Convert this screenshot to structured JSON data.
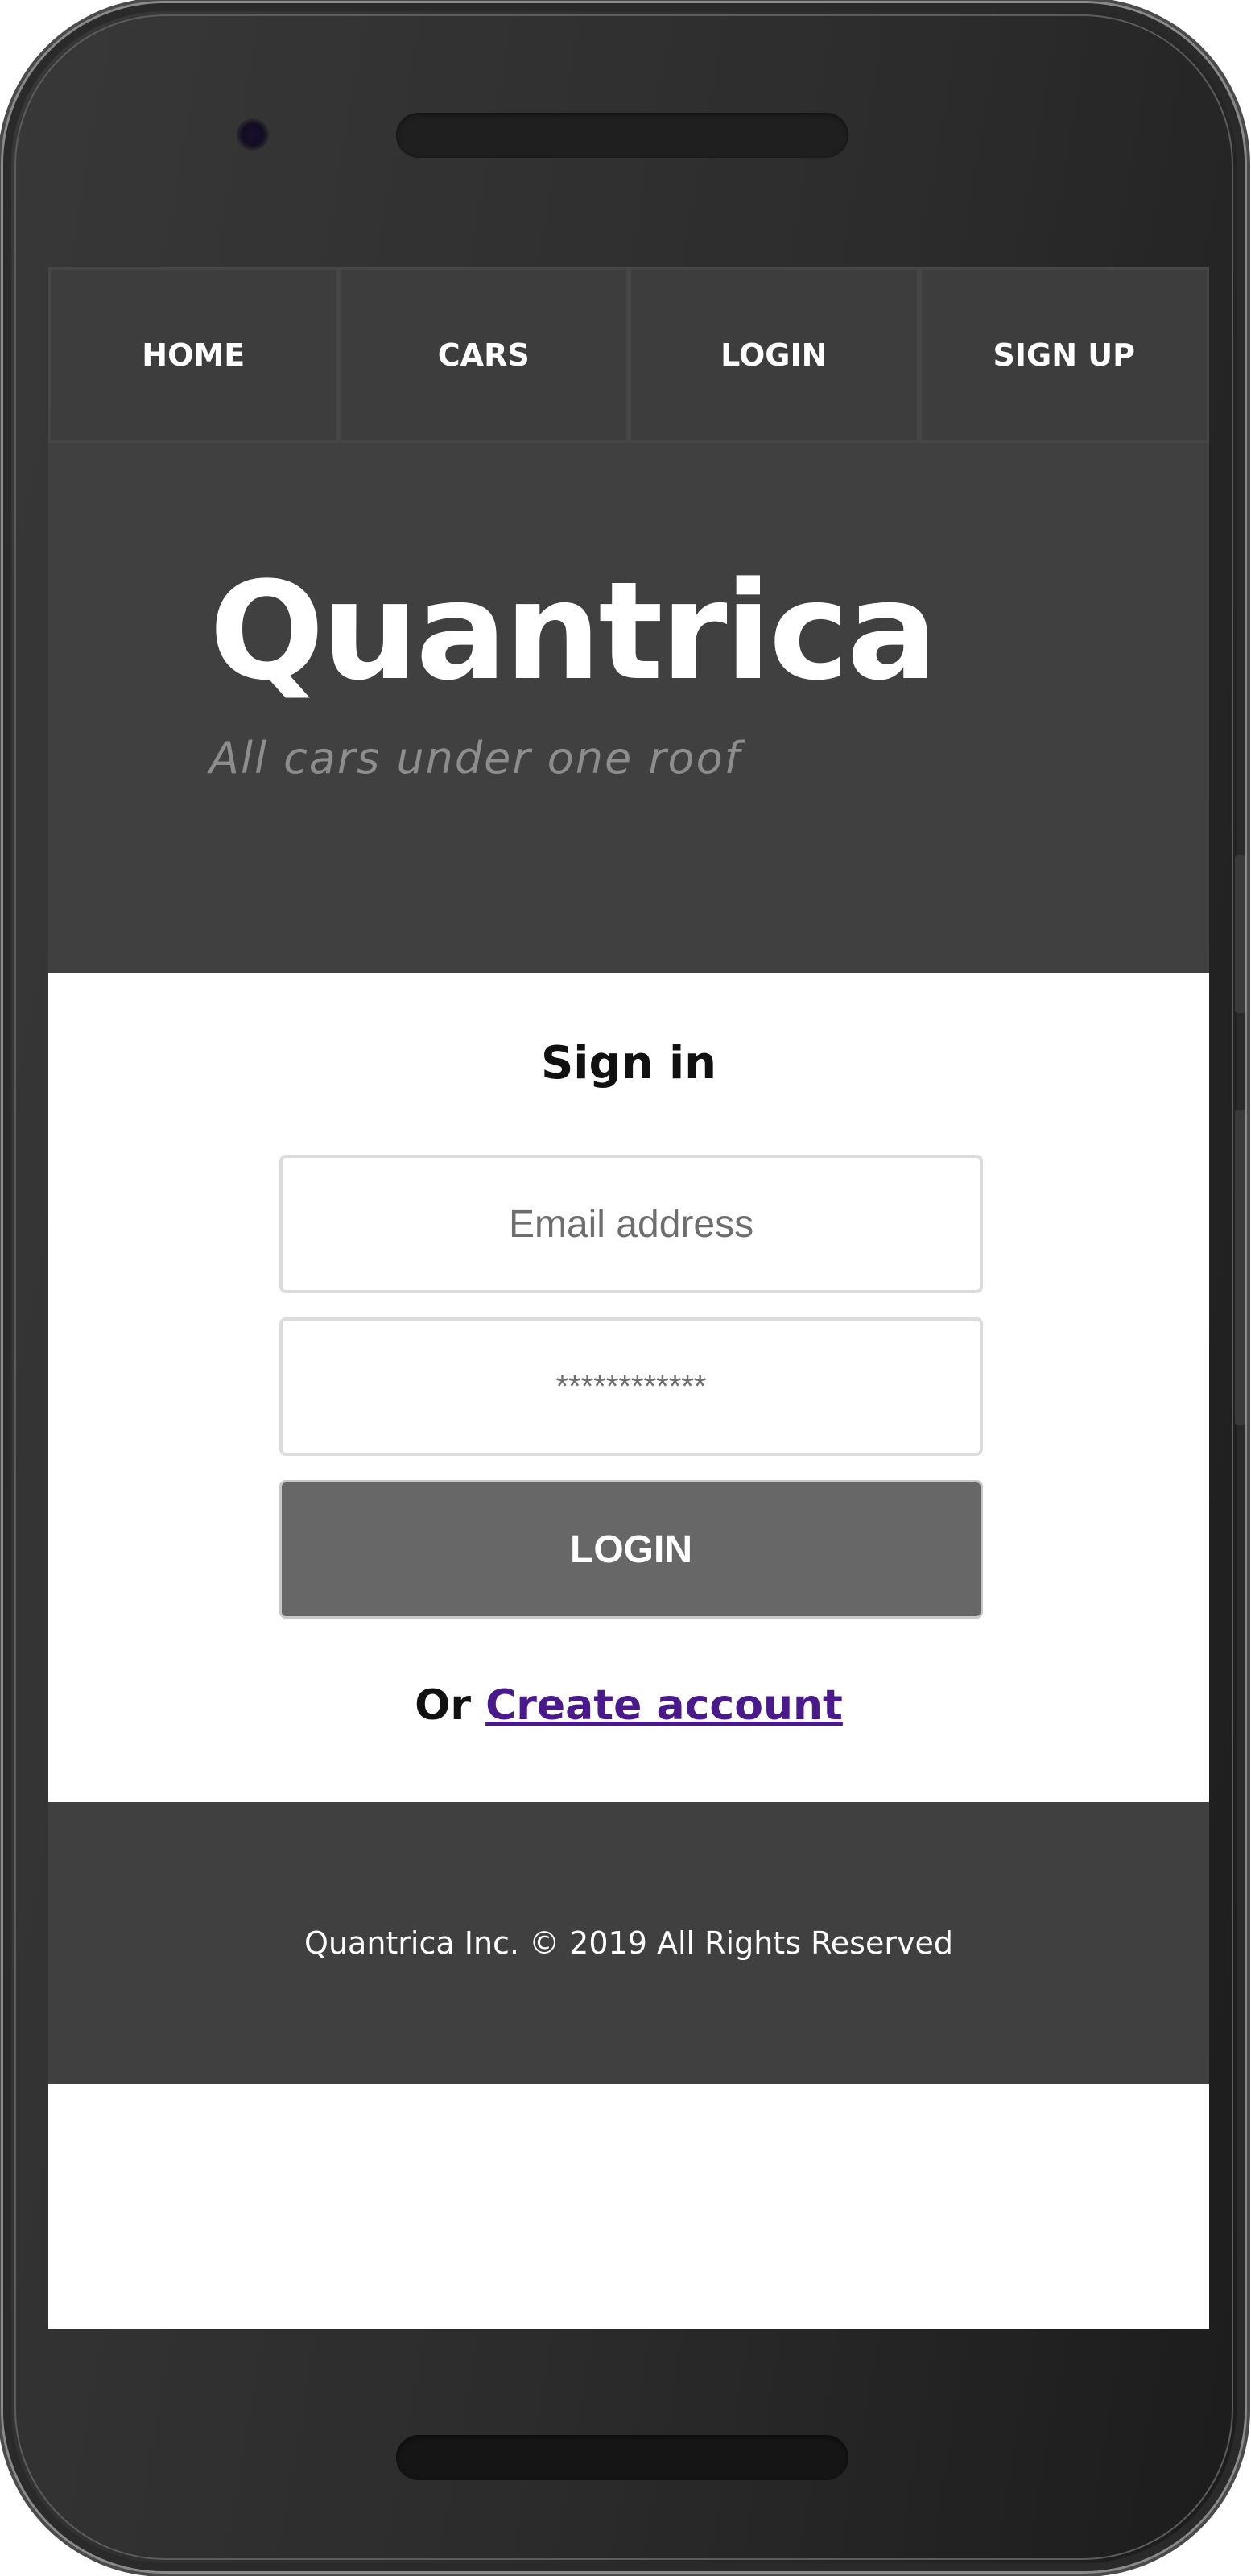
{
  "nav": {
    "items": [
      {
        "label": "HOME"
      },
      {
        "label": "CARS"
      },
      {
        "label": "LOGIN"
      },
      {
        "label": "SIGN UP"
      }
    ]
  },
  "hero": {
    "brand": "Quantrica",
    "tagline": "All cars under one roof"
  },
  "signin": {
    "title": "Sign in",
    "email_placeholder": "Email address",
    "password_placeholder": "************",
    "login_label": "LOGIN",
    "or_text": "Or",
    "create_account_label": "Create account"
  },
  "footer": {
    "text": "Quantrica Inc. © 2019 All Rights Reserved"
  },
  "colors": {
    "header_bg": "#404040",
    "button_bg": "#676767",
    "link": "#4a1a8c"
  }
}
